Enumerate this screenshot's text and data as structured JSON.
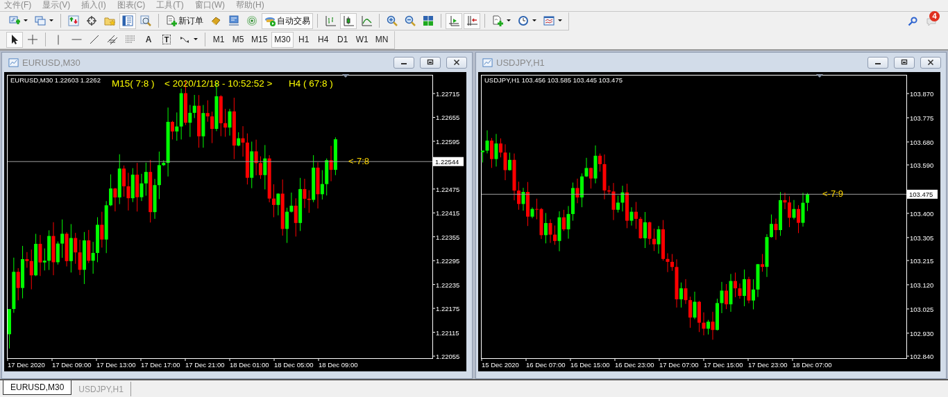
{
  "menu": [
    {
      "label": "文件(F)"
    },
    {
      "label": "显示(V)"
    },
    {
      "label": "插入(I)"
    },
    {
      "label": "图表(C)"
    },
    {
      "label": "工具(T)"
    },
    {
      "label": "窗口(W)"
    },
    {
      "label": "帮助(H)"
    }
  ],
  "toolbars": [
    {
      "groups": [
        [
          {
            "kind": "new-chart",
            "pressed": false,
            "dropdown": true
          },
          {
            "kind": "profiles",
            "pressed": false,
            "dropdown": true
          }
        ],
        [
          {
            "kind": "market-watch",
            "pressed": false
          },
          {
            "kind": "data-window",
            "pressed": false
          },
          {
            "kind": "navigator",
            "pressed": false
          },
          {
            "kind": "terminal",
            "pressed": true
          },
          {
            "kind": "tester",
            "pressed": false
          }
        ],
        [
          {
            "kind": "new-order",
            "pressed": false,
            "label": "新订单"
          },
          {
            "kind": "metaeditor",
            "pressed": false
          },
          {
            "kind": "market",
            "pressed": false
          },
          {
            "kind": "signals",
            "pressed": false
          },
          {
            "kind": "auto-trading",
            "pressed": true,
            "label": "自动交易"
          }
        ],
        [
          {
            "kind": "bar-chart",
            "pressed": false
          },
          {
            "kind": "candle-chart",
            "pressed": true
          },
          {
            "kind": "line-chart",
            "pressed": false
          }
        ],
        [
          {
            "kind": "zoom-in",
            "pressed": false
          },
          {
            "kind": "zoom-out",
            "pressed": false
          },
          {
            "kind": "tile",
            "pressed": false
          }
        ],
        [
          {
            "kind": "autoscroll",
            "pressed": true
          },
          {
            "kind": "chart-shift",
            "pressed": true
          }
        ],
        [
          {
            "kind": "indicators",
            "pressed": false,
            "dropdown": true
          },
          {
            "kind": "periods",
            "pressed": false,
            "dropdown": true
          },
          {
            "kind": "templates",
            "pressed": false,
            "dropdown": true
          }
        ]
      ]
    },
    {
      "groups": [
        [
          {
            "kind": "cursor",
            "pressed": true
          },
          {
            "kind": "crosshair",
            "pressed": false
          }
        ],
        [
          {
            "kind": "vline",
            "pressed": false
          },
          {
            "kind": "hline",
            "pressed": false
          },
          {
            "kind": "trendline",
            "pressed": false
          },
          {
            "kind": "channel",
            "pressed": false
          },
          {
            "kind": "fibo",
            "pressed": false
          },
          {
            "kind": "text",
            "pressed": false,
            "label": "A"
          },
          {
            "kind": "text-label",
            "pressed": false,
            "label": "T"
          },
          {
            "kind": "arrows",
            "pressed": false,
            "dropdown": true
          }
        ],
        [
          {
            "kind": "timeframe",
            "pressed": false,
            "label": "M1"
          },
          {
            "kind": "timeframe",
            "pressed": false,
            "label": "M5"
          },
          {
            "kind": "timeframe",
            "pressed": false,
            "label": "M15"
          },
          {
            "kind": "timeframe",
            "pressed": true,
            "label": "M30"
          },
          {
            "kind": "timeframe",
            "pressed": false,
            "label": "H1"
          },
          {
            "kind": "timeframe",
            "pressed": false,
            "label": "H4"
          },
          {
            "kind": "timeframe",
            "pressed": false,
            "label": "D1"
          },
          {
            "kind": "timeframe",
            "pressed": false,
            "label": "W1"
          },
          {
            "kind": "timeframe",
            "pressed": false,
            "label": "MN"
          }
        ]
      ]
    }
  ],
  "notifications": {
    "count": "4"
  },
  "charts": [
    {
      "title": "EURUSD,M30",
      "info": "EURUSD,M30  1.22603 1.2262",
      "overlay": [
        "M15( 7:8 )",
        "< 2020/12/18 - 10:52:52 >",
        "H4 ( 67:8 )"
      ],
      "marker": "<-7:8",
      "price_label": "1.22544",
      "price_ticks": [
        "1.22715",
        "1.22655",
        "1.22595",
        "1.22475",
        "1.22415",
        "1.22355",
        "1.22295",
        "1.22235",
        "1.22175",
        "1.22115",
        "1.22055"
      ],
      "time_ticks": [
        "17 Dec 2020",
        "17 Dec 09:00",
        "17 Dec 13:00",
        "17 Dec 17:00",
        "17 Dec 21:00",
        "18 Dec 01:00",
        "18 Dec 05:00",
        "18 Dec 09:00"
      ]
    },
    {
      "title": "USDJPY,H1",
      "info": "USDJPY,H1  103.456 103.585 103.445 103.475",
      "marker": "<-7:9",
      "price_label": "103.475",
      "price_ticks": [
        "103.870",
        "103.775",
        "103.680",
        "103.590",
        "103.400",
        "103.305",
        "103.215",
        "103.120",
        "103.025",
        "102.930",
        "102.840"
      ],
      "time_ticks": [
        "15 Dec 2020",
        "16 Dec 07:00",
        "16 Dec 15:00",
        "16 Dec 23:00",
        "17 Dec 07:00",
        "17 Dec 15:00",
        "17 Dec 23:00",
        "18 Dec 07:00"
      ]
    }
  ],
  "tabs": [
    {
      "label": "EURUSD,M30",
      "selected": true
    },
    {
      "label": "USDJPY,H1",
      "selected": false
    }
  ]
}
